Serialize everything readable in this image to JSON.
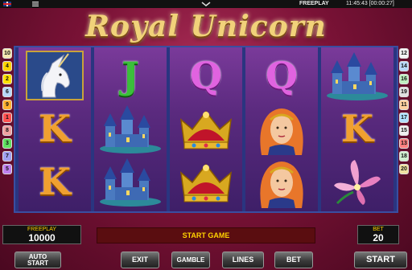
{
  "status_bar": {
    "mode": "FREEPLAY",
    "clock": "11:45:43 [00:00:27]"
  },
  "title": "Royal Unicorn",
  "reels": [
    [
      "unicorn",
      "K",
      "K"
    ],
    [
      "J",
      "castle",
      "castle"
    ],
    [
      "Q",
      "crown",
      "crown"
    ],
    [
      "Q",
      "princess",
      "princess"
    ],
    [
      "castle",
      "K",
      "lily"
    ]
  ],
  "paylines": {
    "left": [
      {
        "n": "10",
        "color": "#f4e8b0"
      },
      {
        "n": "4",
        "color": "#ffd200"
      },
      {
        "n": "2",
        "color": "#ffe000"
      },
      {
        "n": "6",
        "color": "#b8d8f8"
      },
      {
        "n": "9",
        "color": "#ffb030"
      },
      {
        "n": "1",
        "color": "#ff5050"
      },
      {
        "n": "8",
        "color": "#f0a0a0"
      },
      {
        "n": "3",
        "color": "#60e060"
      },
      {
        "n": "7",
        "color": "#a0a0f0"
      },
      {
        "n": "5",
        "color": "#c080f0"
      }
    ],
    "right": [
      {
        "n": "12",
        "color": "#f4f4f4"
      },
      {
        "n": "14",
        "color": "#b8d8f8"
      },
      {
        "n": "16",
        "color": "#c0f0c0"
      },
      {
        "n": "19",
        "color": "#e0e0e0"
      },
      {
        "n": "11",
        "color": "#ffd0a0"
      },
      {
        "n": "17",
        "color": "#b0e0ff"
      },
      {
        "n": "15",
        "color": "#f0f0f0"
      },
      {
        "n": "13",
        "color": "#ff8080"
      },
      {
        "n": "18",
        "color": "#d0f0d0"
      },
      {
        "n": "20",
        "color": "#f0e0a0"
      }
    ]
  },
  "info": {
    "freeplay_label": "FREEPLAY",
    "freeplay_value": "10000",
    "message": "START GAME",
    "bet_label": "BET",
    "bet_value": "20"
  },
  "buttons": {
    "auto_start": [
      "AUTO",
      "START"
    ],
    "exit": "EXIT",
    "gamble": "GAMBLE",
    "lines": "LINES",
    "bet": "BET",
    "start": "START"
  }
}
